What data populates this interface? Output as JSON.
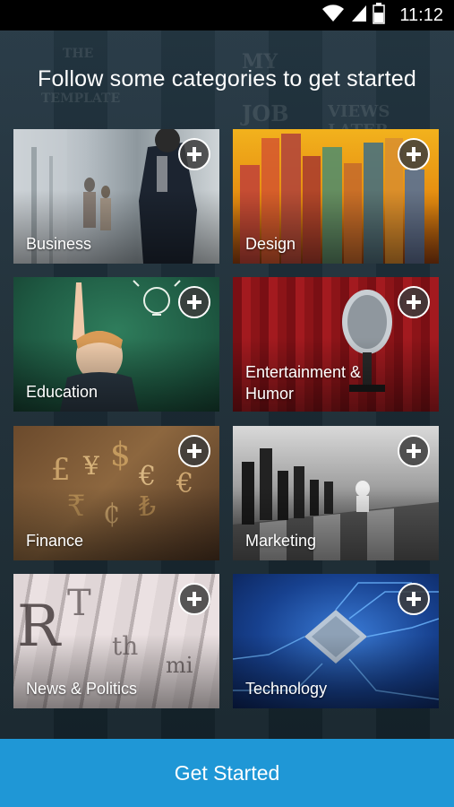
{
  "status_bar": {
    "time": "11:12"
  },
  "header": {
    "title": "Follow some categories to get started"
  },
  "background_words": [
    "THE",
    "TEMPLATE",
    "MY",
    "JOB",
    "VIEWS LATER..."
  ],
  "categories": [
    {
      "label": "Business"
    },
    {
      "label": "Design"
    },
    {
      "label": "Education"
    },
    {
      "label": "Entertainment & Humor"
    },
    {
      "label": "Finance"
    },
    {
      "label": "Marketing"
    },
    {
      "label": "News & Politics"
    },
    {
      "label": "Technology"
    }
  ],
  "cta": {
    "label": "Get Started"
  },
  "colors": {
    "accent": "#1f97d6",
    "background": "#1c2a33"
  }
}
